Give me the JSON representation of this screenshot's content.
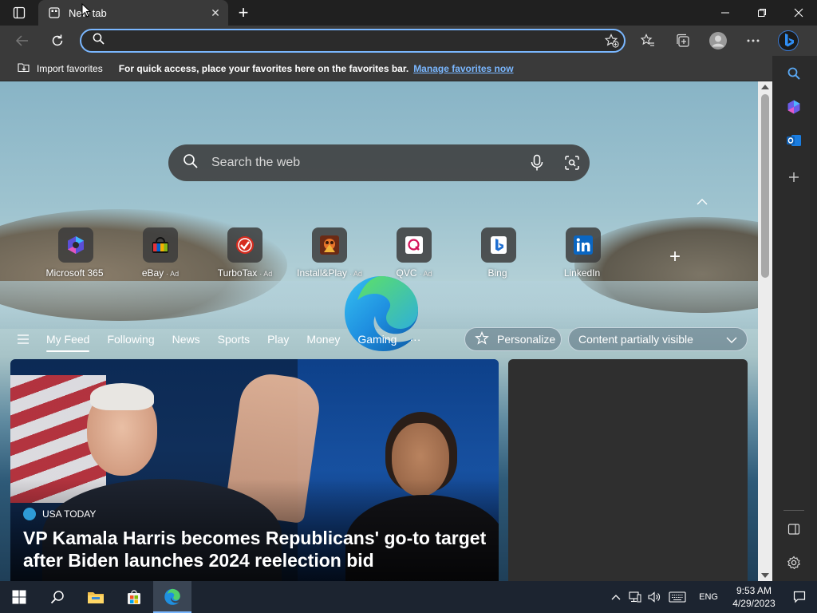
{
  "browser": {
    "tab_title": "New tab",
    "address_value": "",
    "favorites_bar": {
      "import_label": "Import favorites",
      "hint": "For quick access, place your favorites here on the favorites bar.",
      "manage_link": "Manage favorites now"
    }
  },
  "newtab": {
    "search_placeholder": "Search the web",
    "quick_links": [
      {
        "label": "Microsoft 365",
        "ad": "",
        "icon": "microsoft-365-icon"
      },
      {
        "label": "eBay",
        "ad": "· Ad",
        "icon": "ebay-icon"
      },
      {
        "label": "TurboTax",
        "ad": "· Ad",
        "icon": "turbotax-icon"
      },
      {
        "label": "Install&Play",
        "ad": "· Ad",
        "icon": "install-play-icon"
      },
      {
        "label": "QVC",
        "ad": "· Ad",
        "icon": "qvc-icon"
      },
      {
        "label": "Bing",
        "ad": "",
        "icon": "bing-icon"
      },
      {
        "label": "LinkedIn",
        "ad": "",
        "icon": "linkedin-icon"
      }
    ],
    "feed_tabs": [
      "My Feed",
      "Following",
      "News",
      "Sports",
      "Play",
      "Money",
      "Gaming"
    ],
    "more_label": "···",
    "personalize_label": "Personalize",
    "content_visibility": "Content partially visible",
    "top_story": {
      "source": "USA TODAY",
      "headline": "VP Kamala Harris becomes Republicans' go-to target after Biden launches 2024 reelection bid"
    }
  },
  "taskbar": {
    "language": "ENG",
    "time": "9:53 AM",
    "date": "4/29/2023"
  },
  "colors": {
    "accent": "#7ab7ff",
    "chrome": "#3a3a3a",
    "titlebar": "#202020",
    "taskbar": "#1c2430"
  }
}
